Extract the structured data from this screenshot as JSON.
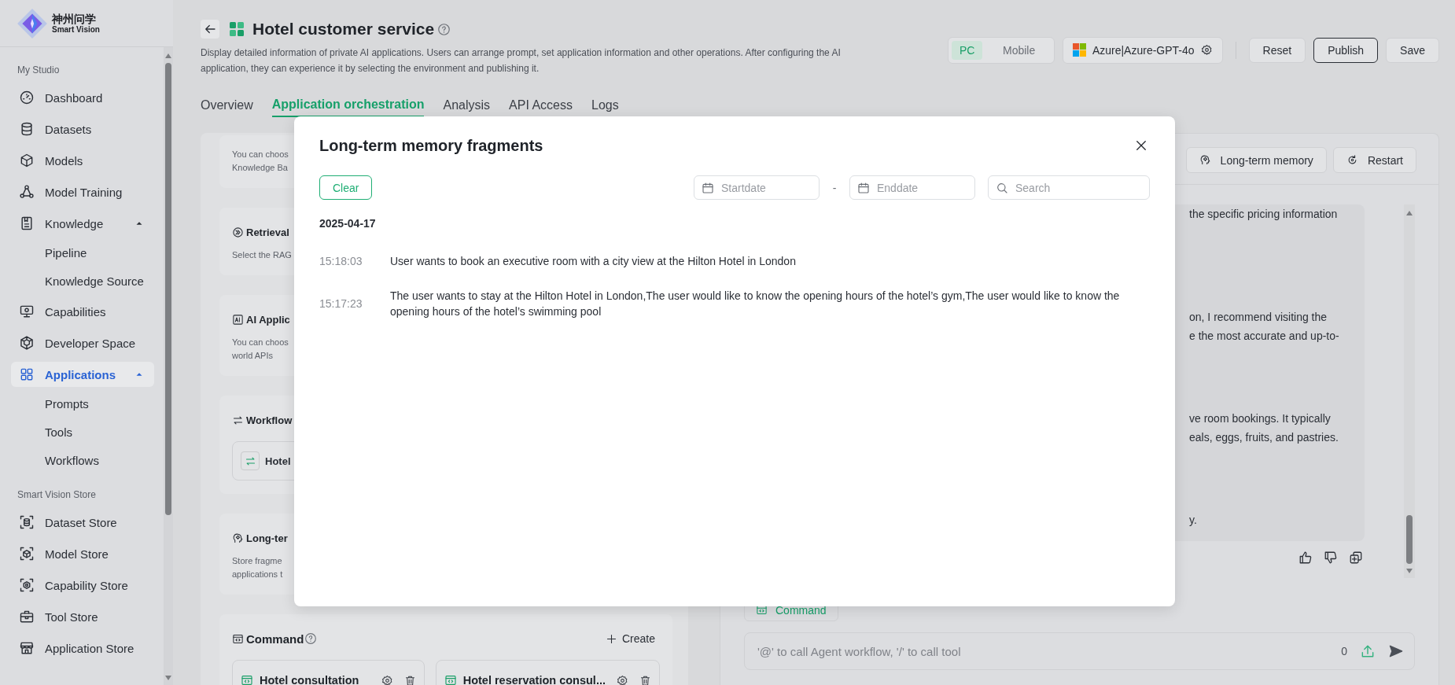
{
  "logo": {
    "name_cn": "神州问学",
    "name_en": "Smart Vision"
  },
  "sidebar": {
    "sections": [
      {
        "title": "My Studio",
        "items": [
          {
            "label": "Dashboard",
            "kind": "gauge",
            "selected": false
          },
          {
            "label": "Datasets",
            "kind": "database",
            "selected": false
          },
          {
            "label": "Models",
            "kind": "cube",
            "selected": false
          },
          {
            "label": "Model Training",
            "kind": "nodes",
            "selected": false
          },
          {
            "label": "Knowledge",
            "kind": "doc",
            "selected": false,
            "expanded": true,
            "children": [
              {
                "label": "Pipeline",
                "selected": false
              },
              {
                "label": "Knowledge Source",
                "selected": false
              }
            ]
          },
          {
            "label": "Capabilities",
            "kind": "monitor",
            "selected": false
          },
          {
            "label": "Developer Space",
            "kind": "hexcube",
            "selected": false
          },
          {
            "label": "Applications",
            "kind": "grid",
            "selected": true,
            "expanded": true,
            "children": [
              {
                "label": "Prompts",
                "selected": false
              },
              {
                "label": "Tools",
                "selected": false
              },
              {
                "label": "Workflows",
                "selected": false
              }
            ]
          }
        ]
      },
      {
        "title": "Smart Vision Store",
        "items": [
          {
            "label": "Dataset Store",
            "kind": "store-database",
            "selected": false
          },
          {
            "label": "Model Store",
            "kind": "store-cube",
            "selected": false
          },
          {
            "label": "Capability Store",
            "kind": "store-monitor",
            "selected": false
          },
          {
            "label": "Tool Store",
            "kind": "toolbox",
            "selected": false
          },
          {
            "label": "Application Store",
            "kind": "shop",
            "selected": false
          }
        ]
      }
    ]
  },
  "header": {
    "title": "Hotel customer service",
    "description": "Display detailed information of private AI applications. Users can arrange prompt, set application information and other operations. After configuring the AI application, they can experience it by selecting the environment and publishing it.",
    "platforms": [
      {
        "label": "PC",
        "selected": true
      },
      {
        "label": "Mobile",
        "selected": false
      }
    ],
    "model": "Azure|Azure-GPT-4o",
    "buttons": [
      {
        "label": "Reset",
        "kind": "default"
      },
      {
        "label": "Publish",
        "kind": "outlined"
      },
      {
        "label": "Save",
        "kind": "default"
      }
    ],
    "tabs": [
      {
        "label": "Overview",
        "selected": false
      },
      {
        "label": "Application orchestration",
        "selected": true
      },
      {
        "label": "Analysis",
        "selected": false
      },
      {
        "label": "API Access",
        "selected": false
      },
      {
        "label": "Logs",
        "selected": false
      }
    ]
  },
  "left_panel": {
    "cards": [
      {
        "kind": "text",
        "description": [
          "You can choos",
          "Knowledge Ba"
        ]
      },
      {
        "kind": "text",
        "title": "Retrieval",
        "description": [
          "Select the RAG"
        ]
      },
      {
        "kind": "text",
        "title": "AI Applic",
        "description": [
          "You can choos",
          "world APIs"
        ]
      },
      {
        "kind": "workflow",
        "title": "Workflow",
        "items": [
          "Hotel"
        ]
      },
      {
        "kind": "text",
        "title": "Long-ter",
        "description": [
          "Store fragme",
          "applications t"
        ]
      },
      {
        "kind": "command",
        "title": "Command",
        "create": "Create",
        "items": [
          "Hotel consultation",
          "Hotel reservation consul..."
        ]
      }
    ]
  },
  "chat": {
    "buttons": [
      {
        "label": "Long-term memory",
        "kind": "head"
      },
      {
        "label": "Restart",
        "kind": "restart"
      }
    ],
    "message_paragraphs": [
      [
        "the specific pricing information"
      ],
      [
        "on, I recommend visiting the",
        "e the most accurate and up-to-"
      ],
      [
        "ve room bookings. It typically",
        "eals, eggs, fruits, and pastries."
      ],
      [
        "y."
      ]
    ],
    "command_button": "Command",
    "input": {
      "placeholder": "'@' to call Agent workflow, '/' to call tool",
      "count": "0"
    }
  },
  "modal": {
    "title": "Long-term memory fragments",
    "clear": "Clear",
    "start_placeholder": "Startdate",
    "separator": "-",
    "end_placeholder": "Enddate",
    "search_placeholder": "Search",
    "groups": [
      {
        "date": "2025-04-17",
        "entries": [
          {
            "time": "15:18:03",
            "text": "User wants to book an executive room with a city view at the Hilton Hotel in London"
          },
          {
            "time": "15:17:23",
            "text": "The user wants to stay at the Hilton Hotel in London,The user would like to know the opening hours of the hotel’s gym,The user would like to know the opening hours of the hotel’s swimming pool"
          }
        ]
      }
    ]
  }
}
